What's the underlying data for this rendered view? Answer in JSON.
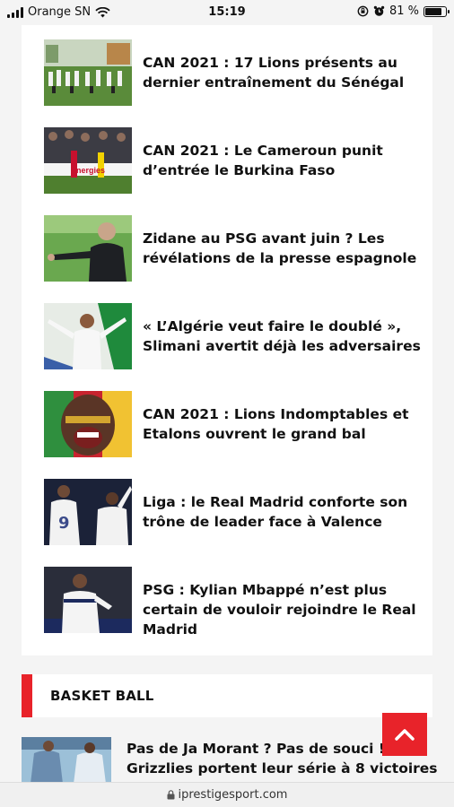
{
  "status_bar": {
    "carrier": "Orange SN",
    "time": "15:19",
    "battery": "81 %",
    "battery_level": 0.81,
    "icons": [
      "signal-icon",
      "wifi-icon",
      "orientation-lock-icon",
      "alarm-icon",
      "battery-icon"
    ]
  },
  "articles": [
    {
      "title": "CAN 2021 : 17 Lions présents au dernier entraînement du Sénégal",
      "thumb": "training"
    },
    {
      "title": "CAN 2021 : Le Cameroun punit d’entrée le Burkina Faso",
      "thumb": "stadium"
    },
    {
      "title": "Zidane au PSG avant juin ? Les révélations de la presse espagnole",
      "thumb": "coach"
    },
    {
      "title": "« L’Algérie veut faire le doublé », Slimani avertit déjà les adversaires",
      "thumb": "algeria"
    },
    {
      "title": "CAN 2021 : Lions Indomptables et Etalons ouvrent le grand bal",
      "thumb": "fan"
    },
    {
      "title": "Liga : le Real Madrid conforte son trône de leader face à Valence",
      "thumb": "real"
    },
    {
      "title": "PSG : Kylian Mbappé n’est plus certain de vouloir rejoindre le Real Madrid",
      "thumb": "psg"
    }
  ],
  "section": {
    "title": "BASKET BALL"
  },
  "basket_article": {
    "title": "Pas de Ja Morant ? Pas de souci ! Les Grizzlies portent leur série à 8 victoires"
  },
  "stadium_banner_text": "Energies",
  "url_bar": {
    "domain": "iprestigesport.com"
  },
  "colors": {
    "accent": "#e8232a"
  }
}
